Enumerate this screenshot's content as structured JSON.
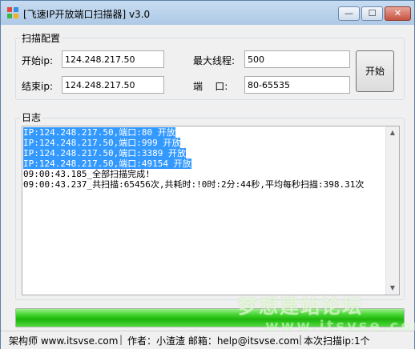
{
  "window": {
    "title": "[飞速IP开放端口扫描器] v3.0",
    "controls": {
      "minimize": "—",
      "maximize": "☐",
      "close": "✕"
    }
  },
  "config": {
    "group_label": "扫描配置",
    "start_ip_label": "开始ip:",
    "start_ip_value": "124.248.217.50",
    "end_ip_label": "结束ip:",
    "end_ip_value": "124.248.217.50",
    "threads_label": "最大线程:",
    "threads_value": "500",
    "port_label": "端    口:",
    "port_value": "80-65535",
    "start_button": "开始"
  },
  "log": {
    "group_label": "日志",
    "lines": [
      "IP:124.248.217.50,端口:80 开放",
      "IP:124.248.217.50,端口:999 开放",
      "IP:124.248.217.50,端口:3389 开放",
      "IP:124.248.217.50,端口:49154 开放",
      "09:00:43.185_全部扫描完成!",
      "09:00:43.237_共扫描:65456次,共耗时:!0时:2分:44秒,平均每秒扫描:398.31次"
    ],
    "selected_line_count": 4
  },
  "progress": {
    "percent": 100,
    "color": "#2fc41c"
  },
  "status": {
    "architect": "架构师 www.itsvse.com",
    "author": "作者：小渣渣 邮箱：help@itsvse.com",
    "ip_count": "本次扫描ip:1个"
  },
  "watermark": {
    "line1": "梦想建站论坛",
    "line2": "www.itsvse.com"
  }
}
